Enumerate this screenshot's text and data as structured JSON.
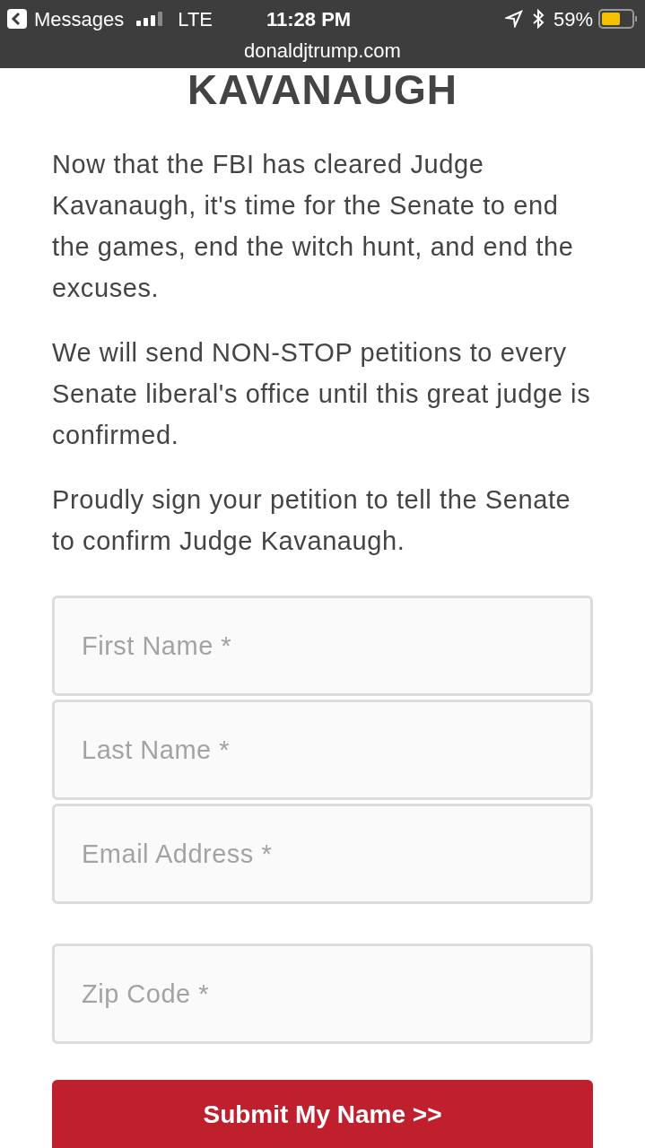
{
  "status_bar": {
    "back_label": "Messages",
    "network": "LTE",
    "time": "11:28 PM",
    "battery": "59%",
    "url": "donaldjtrump.com"
  },
  "heading": "KAVANAUGH",
  "paragraphs": [
    "Now that the FBI has cleared Judge Kavanaugh, it's time for the Senate to end the games, end the witch hunt, and end the excuses.",
    "We will send NON-STOP petitions to every Senate liberal's office until this great judge is confirmed.",
    "Proudly sign your petition to tell the Senate to confirm Judge Kavanaugh."
  ],
  "form": {
    "fields": [
      {
        "placeholder": "First Name *"
      },
      {
        "placeholder": "Last Name *"
      },
      {
        "placeholder": "Email Address *"
      },
      {
        "placeholder": "Zip Code *"
      }
    ],
    "submit": "Submit My Name >>"
  }
}
